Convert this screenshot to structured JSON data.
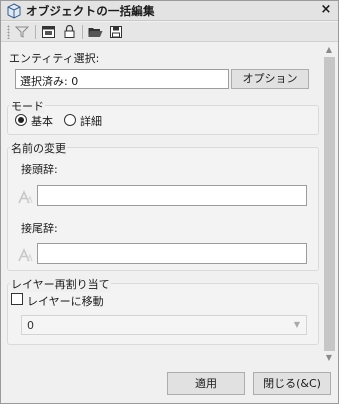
{
  "window": {
    "title": "オブジェクトの一括編集",
    "close_label": "×",
    "icon": "object-cube-icon"
  },
  "toolbar": {
    "items": [
      "filter-icon",
      "window-icon",
      "lock-icon",
      "open-folder-icon",
      "save-icon"
    ]
  },
  "entity_selection": {
    "label": "エンティティ選択:",
    "selected_text": "選択済み: 0",
    "options_button": "オプション"
  },
  "mode": {
    "title": "モード",
    "options": [
      {
        "label": "基本",
        "checked": true
      },
      {
        "label": "詳細",
        "checked": false
      }
    ]
  },
  "rename": {
    "title": "名前の変更",
    "prefix_label": "接頭辞:",
    "prefix_value": "",
    "suffix_label": "接尾辞:",
    "suffix_value": ""
  },
  "layer": {
    "title": "レイヤー再割り当て",
    "move_label": "レイヤーに移動",
    "move_checked": false,
    "selected_layer": "0"
  },
  "footer": {
    "apply_button": "適用",
    "close_button": "閉じる(&C)"
  },
  "colors": {
    "title_bg": "#e3e3e3",
    "panel_bg": "#f0f0f0",
    "button_bg": "#e1e1e1"
  }
}
